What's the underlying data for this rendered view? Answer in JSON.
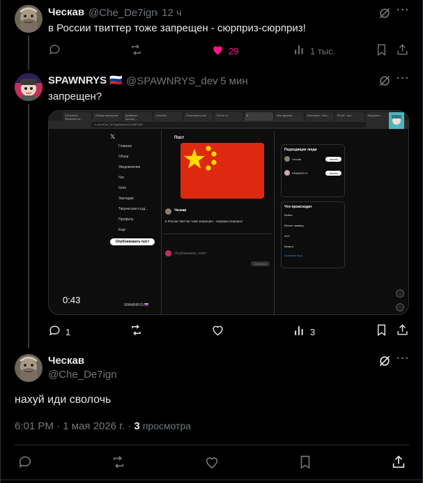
{
  "tweet1": {
    "name": "Ческав",
    "handle": "@Che_De7ign",
    "time": "· 12 ч",
    "text": "в России твиттер тоже запрещен - сюрприз-сюрприз!",
    "likes": "29",
    "views": "1 тыс."
  },
  "tweet2": {
    "name": "SPAWNRYS",
    "flag": "🇷🇺",
    "handle": "@SPAWNRYS_dev",
    "time": "· 5 мин",
    "text": "запрещен?",
    "video_time": "0:43",
    "replies": "1",
    "views": "3"
  },
  "video_frame": {
    "tabs": [
      "Chromium - Windows bu...",
      "Сборка фильтров",
      "Добавить фильтр...",
      "Chat Ask",
      "Посмотреть как",
      "Посты от",
      "X",
      "Как сделать...",
      "Download - Inko...",
      "Ютуб - это...",
      "Загрузить"
    ],
    "url": "x.com/Che_De7ign/status/1234567890",
    "nav": [
      "Главная",
      "Обзор",
      "Уведомления",
      "Чат",
      "Grok",
      "Закладки",
      "Творческая студ...",
      "Профиль",
      "Еще"
    ],
    "post_button": "Опубликовать пост",
    "post_title": "Пост",
    "inner_tweet_name": "Ческав",
    "inner_tweet_text": "в России твиттер тоже запрещен - сюрприз-сюрприз!",
    "inner_reply": "Опубликовать ответ",
    "reply_button": "Ответить",
    "follow_title": "Подходящие люди",
    "follow_btn": "Читать",
    "whats_title": "Что происходит",
    "whats_items": [
      "Война",
      "Малое правящ",
      "AVX",
      "Вопрос"
    ],
    "show_more": "Показать еще",
    "user_label": "SPAWNRYS 🇷🇺"
  },
  "main_tweet": {
    "name": "Ческав",
    "handle": "@Che_De7ign",
    "text": "нахуй иди сволочь",
    "meta": "6:01 PM · 1 мая 2026 г. ·",
    "views_count": "3",
    "views_label": "просмотра"
  },
  "colors": {
    "like_pink": "#f91880",
    "muted": "#71767b",
    "text": "#e7e9ea",
    "border": "#2f3336",
    "flag_red": "#de2910",
    "flag_yellow": "#ffde00"
  },
  "icons": [
    "grok-icon",
    "more-icon",
    "reply-icon",
    "retweet-icon",
    "like-icon",
    "views-icon",
    "bookmark-icon",
    "share-icon"
  ]
}
